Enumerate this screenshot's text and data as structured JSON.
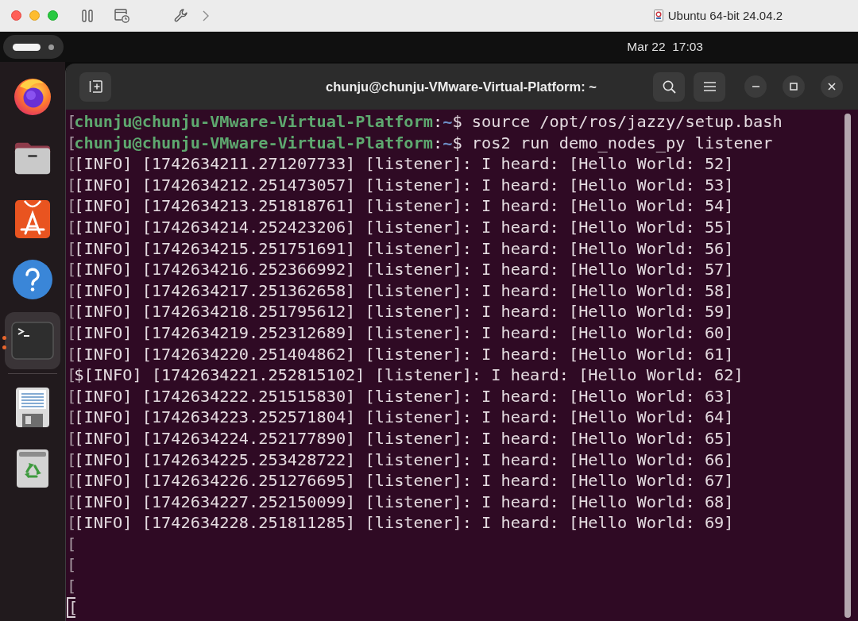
{
  "host_window": {
    "title": "Ubuntu 64-bit 24.04.2"
  },
  "top_bar": {
    "clock": "Mar 22  17:03"
  },
  "dock": {
    "apps": [
      {
        "kind": "browser",
        "selected": false,
        "running": false
      },
      {
        "kind": "files",
        "selected": false,
        "running": false
      },
      {
        "kind": "store",
        "selected": false,
        "running": false
      },
      {
        "kind": "help",
        "selected": false,
        "running": false
      },
      {
        "kind": "terminal",
        "selected": true,
        "running": true
      }
    ],
    "places": [
      {
        "kind": "volume",
        "selected": false,
        "running": false
      },
      {
        "kind": "trash",
        "selected": false,
        "running": false
      }
    ]
  },
  "terminal": {
    "title": "chunju@chunju-VMware-Virtual-Platform: ~",
    "lines": [
      {
        "kind": "prompt",
        "edge": "[",
        "segments": [
          {
            "kind": "user",
            "text": "chunju@chunju-VMware-Virtual-Platform"
          },
          {
            "kind": "plain",
            "text": ":"
          },
          {
            "kind": "path",
            "text": "~"
          },
          {
            "kind": "plain",
            "text": "$ source /opt/ros/jazzy/setup.bash"
          }
        ]
      },
      {
        "kind": "prompt",
        "edge": "[",
        "segments": [
          {
            "kind": "user",
            "text": "chunju@chunju-VMware-Virtual-Platform"
          },
          {
            "kind": "plain",
            "text": ":"
          },
          {
            "kind": "path",
            "text": "~"
          },
          {
            "kind": "plain",
            "text": "$ ros2 run demo_nodes_py listener"
          }
        ]
      },
      {
        "kind": "output",
        "edge": "[",
        "text": "[INFO] [1742634211.271207733] [listener]: I heard: [Hello World: 52]"
      },
      {
        "kind": "output",
        "edge": "[",
        "text": "[INFO] [1742634212.251473057] [listener]: I heard: [Hello World: 53]"
      },
      {
        "kind": "output",
        "edge": "[",
        "text": "[INFO] [1742634213.251818761] [listener]: I heard: [Hello World: 54]"
      },
      {
        "kind": "output",
        "edge": "[",
        "text": "[INFO] [1742634214.252423206] [listener]: I heard: [Hello World: 55]"
      },
      {
        "kind": "output",
        "edge": "[",
        "text": "[INFO] [1742634215.251751691] [listener]: I heard: [Hello World: 56]"
      },
      {
        "kind": "output",
        "edge": "[",
        "text": "[INFO] [1742634216.252366992] [listener]: I heard: [Hello World: 57]"
      },
      {
        "kind": "output",
        "edge": "[",
        "text": "[INFO] [1742634217.251362658] [listener]: I heard: [Hello World: 58]"
      },
      {
        "kind": "output",
        "edge": "[",
        "text": "[INFO] [1742634218.251795612] [listener]: I heard: [Hello World: 59]"
      },
      {
        "kind": "output",
        "edge": "[",
        "text": "[INFO] [1742634219.252312689] [listener]: I heard: [Hello World: 60]"
      },
      {
        "kind": "output",
        "edge": "[",
        "text": "[INFO] [1742634220.251404862] [listener]: I heard: [Hello World: 61]"
      },
      {
        "kind": "output",
        "edge": "[",
        "text": "$[INFO] [1742634221.252815102] [listener]: I heard: [Hello World: 62]"
      },
      {
        "kind": "output",
        "edge": "[",
        "text": "[INFO] [1742634222.251515830] [listener]: I heard: [Hello World: 63]"
      },
      {
        "kind": "output",
        "edge": "[",
        "text": "[INFO] [1742634223.252571804] [listener]: I heard: [Hello World: 64]"
      },
      {
        "kind": "output",
        "edge": "[",
        "text": "[INFO] [1742634224.252177890] [listener]: I heard: [Hello World: 65]"
      },
      {
        "kind": "output",
        "edge": "[",
        "text": "[INFO] [1742634225.253428722] [listener]: I heard: [Hello World: 66]"
      },
      {
        "kind": "output",
        "edge": "[",
        "text": "[INFO] [1742634226.251276695] [listener]: I heard: [Hello World: 67]"
      },
      {
        "kind": "output",
        "edge": "[",
        "text": "[INFO] [1742634227.252150099] [listener]: I heard: [Hello World: 68]"
      },
      {
        "kind": "output",
        "edge": "[",
        "text": "[INFO] [1742634228.251811285] [listener]: I heard: [Hello World: 69]"
      },
      {
        "kind": "blank",
        "edge": "["
      },
      {
        "kind": "blank",
        "edge": "["
      },
      {
        "kind": "blank",
        "edge": "["
      },
      {
        "kind": "cursor",
        "edge": "["
      }
    ]
  }
}
